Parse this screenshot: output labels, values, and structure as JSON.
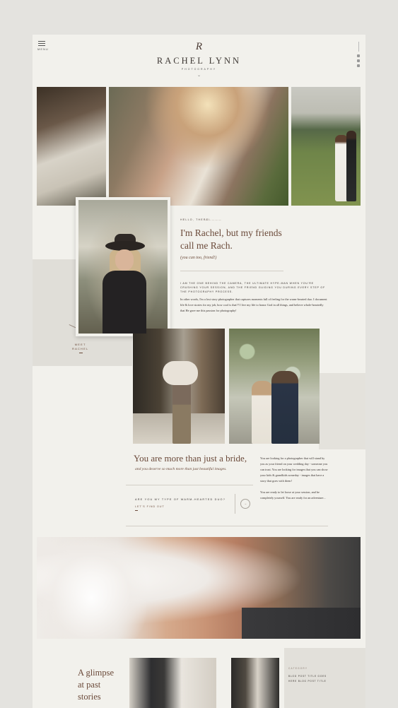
{
  "header": {
    "menu_label": "MENU",
    "logo_mark": "R",
    "brand": "RACHEL LYNN",
    "brand_sub": "PHOTOGRAPHY",
    "chevron": "⌄"
  },
  "about": {
    "hello": "HELLO, THERE!",
    "hello_tag": "—————",
    "headline_1": "I'm Rachel, but my friends",
    "headline_2": "call me Rach.",
    "subhead": "(you can too, friend!)",
    "caps_paragraph": "I AM THE ONE BEHIND THE CAMERA, THE ULTIMATE HYPE-MAN WHEN YOU'RE CRUSHING YOUR SESSION, AND THE FRIEND GUIDING YOU DURING EVERY STEP OF THE PHOTOGRAPHY PROCESS.",
    "body_paragraph": "In other words, I'm a lost story photographer that captures moments full of feeling for the warm-hearted duo. I document life & love stories for my job, how cool is that?! I live my life to honor God in all things, and believe whole-heartedly that He gave me this passion for photography!",
    "meet_label_1": "MEET",
    "meet_label_2": "RACHEL"
  },
  "more": {
    "title": "You are more than just a bride,",
    "subtitle": "and you deserve so much more than just beautiful images.",
    "duo_question": "ARE YOU MY TYPE OF WARM-HEARTED DUO?",
    "find_out": "LET'S FIND OUT",
    "circle_arrow": "→",
    "right_p1": "You are looking for a photographer that will stand by you as your friend on your wedding day - someone you can trust. You are looking for images that you can show your kids & grandkids someday - images that have a story that goes with them!",
    "right_p2": "You are ready to let loose at your session, and be completely yourself. You are ready for an adventure..."
  },
  "blog": {
    "glimpse": "A glimpse at past stories",
    "categories_label": "CATEGORY",
    "items": [
      "BLOG POST TITLE GOES",
      "HERE BLOG POST TITLE"
    ]
  },
  "colors": {
    "page_bg": "#f2f1ec",
    "outer_bg": "#e4e3df",
    "accent_brown": "#6b4a3a",
    "beige_block": "#e0ded8"
  },
  "icons": [
    "menu-icon",
    "instagram-icon",
    "pinterest-icon",
    "facebook-icon",
    "arrow-right-icon",
    "chevron-down-icon"
  ]
}
